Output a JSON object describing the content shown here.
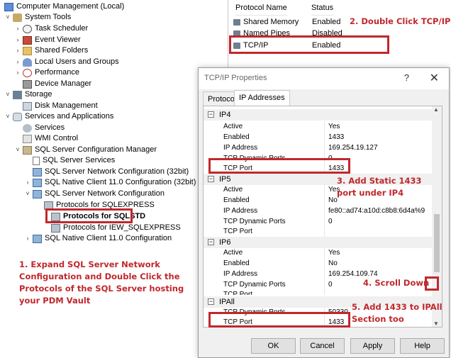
{
  "tree": {
    "root": "Computer Management (Local)",
    "system_tools": "System Tools",
    "task_scheduler": "Task Scheduler",
    "event_viewer": "Event Viewer",
    "shared_folders": "Shared Folders",
    "local_users": "Local Users and Groups",
    "performance": "Performance",
    "device_manager": "Device Manager",
    "storage": "Storage",
    "disk_management": "Disk Management",
    "services_apps": "Services and Applications",
    "services": "Services",
    "wmi": "WMI Control",
    "sql_config": "SQL Server Configuration Manager",
    "sql_services": "SQL Server Services",
    "sql_net_32": "SQL Server Network Configuration (32bit)",
    "native_client_32": "SQL Native Client 11.0 Configuration (32bit)",
    "sql_net": "SQL Server Network Configuration",
    "proto_sqlexpress": "Protocols for SQLEXPRESS",
    "proto_sqlstd": "Protocols for SQLSTD",
    "proto_iew": "Protocols for IEW_SQLEXPRESS",
    "native_client": "SQL Native Client 11.0 Configuration"
  },
  "list": {
    "col_name": "Protocol Name",
    "col_status": "Status",
    "rows": [
      {
        "name": "Shared Memory",
        "status": "Enabled"
      },
      {
        "name": "Named Pipes",
        "status": "Disabled"
      },
      {
        "name": "TCP/IP",
        "status": "Enabled"
      }
    ]
  },
  "dialog": {
    "title": "TCP/IP Properties",
    "help": "?",
    "close": "✕",
    "tab_protocol": "Protocol",
    "tab_ip": "IP Addresses",
    "ip4": {
      "label": "IP4",
      "active_k": "Active",
      "active_v": "Yes",
      "enabled_k": "Enabled",
      "enabled_v": "1433",
      "addr_k": "IP Address",
      "addr_v": "169.254.19.127",
      "dyn_k": "TCP Dynamic Ports",
      "dyn_v": "0",
      "port_k": "TCP Port",
      "port_v": "1433"
    },
    "ip5": {
      "label": "IP5",
      "active_k": "Active",
      "active_v": "Yes",
      "enabled_k": "Enabled",
      "enabled_v": "No",
      "addr_k": "IP Address",
      "addr_v": "fe80::ad74:a10d:c8b8:6d4a%9",
      "dyn_k": "TCP Dynamic Ports",
      "dyn_v": "0",
      "port_k": "TCP Port",
      "port_v": ""
    },
    "ip6": {
      "label": "IP6",
      "active_k": "Active",
      "active_v": "Yes",
      "enabled_k": "Enabled",
      "enabled_v": "No",
      "addr_k": "IP Address",
      "addr_v": "169.254.109.74",
      "dyn_k": "TCP Dynamic Ports",
      "dyn_v": "0",
      "port_k": "TCP Port",
      "port_v": ""
    },
    "ipall": {
      "label": "IPAll",
      "dyn_k": "TCP Dynamic Ports",
      "dyn_v": "50330",
      "port_k": "TCP Port",
      "port_v": "1433"
    },
    "ok": "OK",
    "cancel": "Cancel",
    "apply": "Apply",
    "helpbtn": "Help"
  },
  "annotations": {
    "step1": "1. Expand SQL Server Network Configuration and Double Click the Protocols of the SQL Server hosting your PDM Vault",
    "step2": "2. Double Click TCP/IP",
    "step3": "3. Add Static 1433 port under IP4",
    "step4": "4. Scroll Down",
    "step5": "5. Add 1433 to IPAll Section too"
  },
  "colors": {
    "annotation": "#c0282d"
  }
}
